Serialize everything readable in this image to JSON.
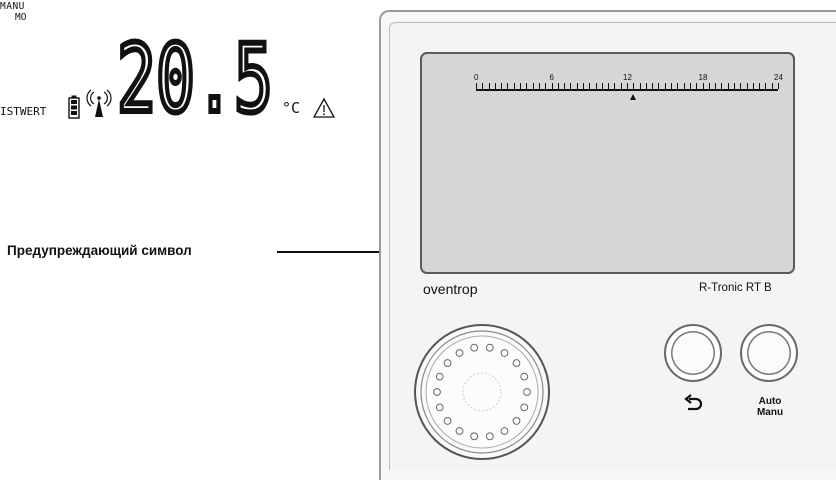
{
  "callout": {
    "label": "Предупреждающий символ"
  },
  "device": {
    "brand": "oventrop",
    "model": "R-Tronic RT B",
    "buttons": {
      "back_icon": "back-arrow-icon",
      "auto_manu_label": "Auto\nManu"
    }
  },
  "display": {
    "mode_line1": "MANU",
    "mode_line2": "MO",
    "timeline_labels": [
      "0",
      "6",
      "12",
      "18",
      "24"
    ],
    "time_marker_hour": 12.5,
    "setpoint_label": "ISTWERT",
    "temperature": "20.5",
    "unit": "°C",
    "icons": [
      "battery-icon",
      "radio-signal-icon",
      "warning-icon"
    ]
  }
}
